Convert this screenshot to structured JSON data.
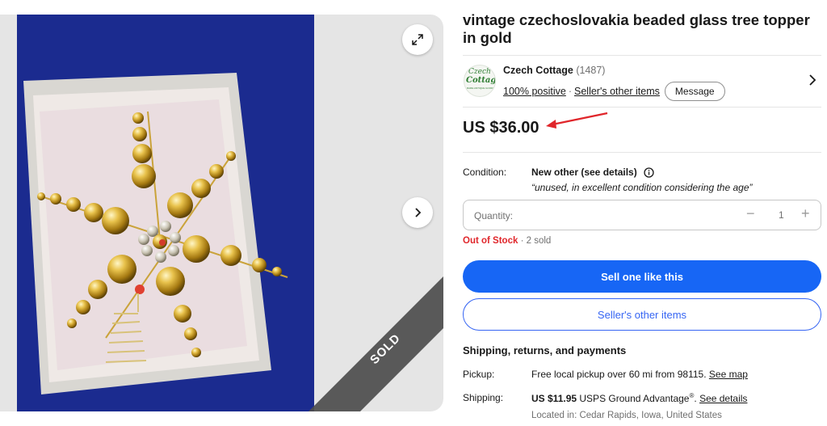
{
  "listing": {
    "title": "vintage czechoslovakia beaded glass tree topper in gold"
  },
  "gallery": {
    "sold_label": "SOLD"
  },
  "seller": {
    "name": "Czech Cottage",
    "feedback_count": "(1487)",
    "positive": "100% positive",
    "other_items": "Seller's other items",
    "message_label": "Message",
    "logo_lines": [
      "Czech",
      "Cottage",
      "RARE ANTIQUE GOODS"
    ]
  },
  "price": {
    "amount": "US $36.00"
  },
  "condition": {
    "label": "Condition:",
    "value": "New other (see details)",
    "quote": "“unused, in excellent condition considering the age”"
  },
  "quantity": {
    "label": "Quantity:",
    "value": "1",
    "minus": "−",
    "plus": "+"
  },
  "stock": {
    "status": "Out of Stock",
    "sold": "· 2 sold"
  },
  "buttons": {
    "primary": "Sell one like this",
    "secondary": "Seller's other items"
  },
  "shipping": {
    "heading": "Shipping, returns, and payments",
    "pickup_label": "Pickup:",
    "pickup_text": "Free local pickup over 60 mi from 98115.",
    "pickup_link": "See map",
    "shipping_label": "Shipping:",
    "shipping_price": "US $11.95",
    "shipping_service": "USPS Ground Advantage",
    "shipping_reg": "®",
    "shipping_link": "See details",
    "located": "Located in: Cedar Rapids, Iowa, United States"
  },
  "colors": {
    "accent_blue": "#1766f5",
    "out_of_stock_red": "#e0262b",
    "annotation_arrow": "#e0262b"
  }
}
